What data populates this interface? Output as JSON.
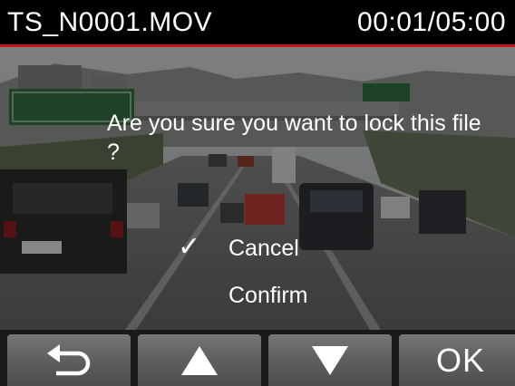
{
  "title_bar": {
    "filename": "TS_N0001.MOV",
    "timecode": "00:01/05:00",
    "accent_color": "#c4161c"
  },
  "dialog": {
    "question": "Are you sure you want to lock this file ?",
    "options": [
      {
        "label": "Cancel",
        "selected": true,
        "check_glyph": "✓"
      },
      {
        "label": "Confirm",
        "selected": false,
        "check_glyph": ""
      }
    ]
  },
  "buttons": {
    "back_icon": "return-arrow-icon",
    "up_icon": "triangle-up-icon",
    "down_icon": "triangle-down-icon",
    "ok_label": "OK"
  }
}
